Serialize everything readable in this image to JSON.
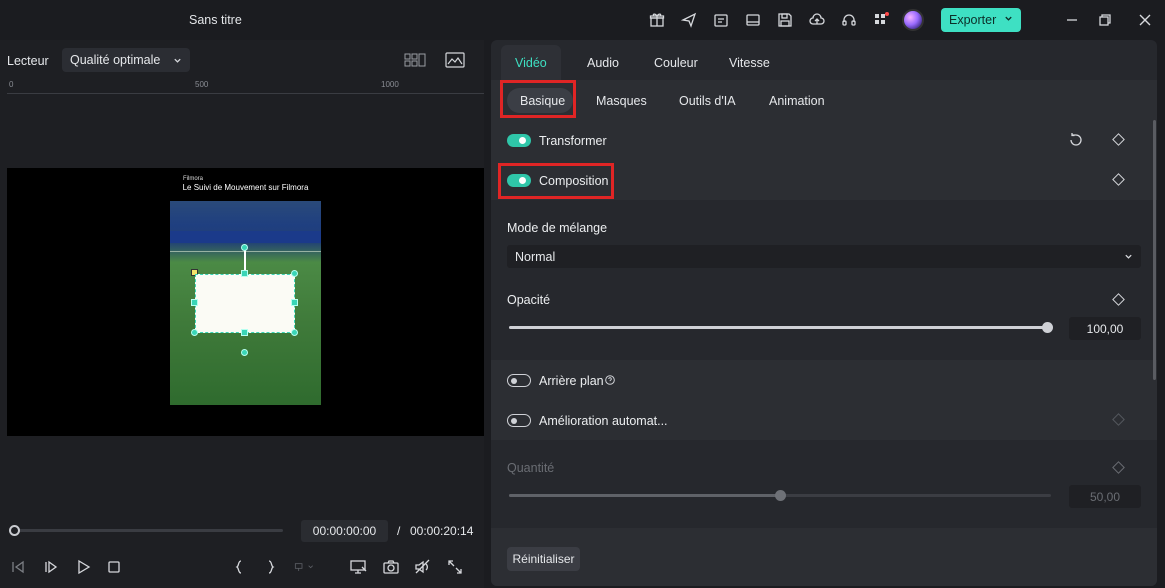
{
  "window": {
    "title": "Sans titre",
    "export_label": "Exporter"
  },
  "player": {
    "label": "Lecteur",
    "quality": "Qualité optimale",
    "ruler_ticks": [
      "0",
      "500",
      "1000"
    ],
    "video_title": "Le Suivi de Mouvement sur Filmora",
    "video_brand": "Filmora",
    "current_time": "00:00:00:00",
    "separator": "/",
    "duration": "00:00:20:14",
    "progress": 0
  },
  "panel": {
    "tabs": [
      "Vidéo",
      "Audio",
      "Couleur",
      "Vitesse"
    ],
    "active_tab": "Vidéo",
    "subtabs": [
      "Basique",
      "Masques",
      "Outils d'IA",
      "Animation"
    ],
    "active_subtab": "Basique",
    "transform_label": "Transformer",
    "composition_label": "Composition",
    "blend_label": "Mode de mélange",
    "blend_value": "Normal",
    "opacity_label": "Opacité",
    "opacity_value": "100,00",
    "opacity_level": 1.0,
    "background_label": "Arrière plan",
    "auto_enhance_label": "Amélioration automat...",
    "quantity_label": "Quantité",
    "quantity_value": "50,00",
    "quantity_level": 0.5,
    "reset_label": "Réinitialiser"
  },
  "colors": {
    "accent": "#3ee0c3",
    "highlight": "#e02525",
    "toggle_on": "#2fc6a9"
  }
}
